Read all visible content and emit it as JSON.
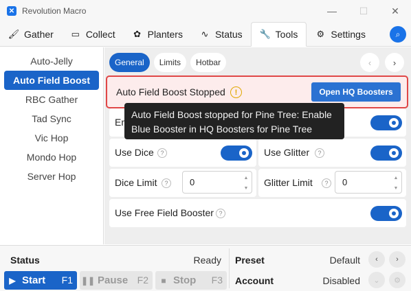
{
  "window": {
    "app_icon": "macro-icon",
    "title": "Revolution Macro",
    "minimize": "—",
    "maximize": "☐",
    "close": "✕"
  },
  "tabs": [
    {
      "label": "Gather",
      "icon": "brush-icon",
      "glyph": "🖌"
    },
    {
      "label": "Collect",
      "icon": "ticket-icon",
      "glyph": "▭"
    },
    {
      "label": "Planters",
      "icon": "plant-icon",
      "glyph": "✿"
    },
    {
      "label": "Status",
      "icon": "pulse-icon",
      "glyph": "∿"
    },
    {
      "label": "Tools",
      "icon": "wrench-icon",
      "glyph": "🔧",
      "active": true
    },
    {
      "label": "Settings",
      "icon": "gear-icon",
      "glyph": "⚙"
    }
  ],
  "search_glyph": "⌕",
  "sidebar": {
    "items": [
      {
        "label": "Auto-Jelly"
      },
      {
        "label": "Auto Field Boost",
        "active": true
      },
      {
        "label": "RBC Gather"
      },
      {
        "label": "Tad Sync"
      },
      {
        "label": "Vic Hop"
      },
      {
        "label": "Mondo Hop"
      },
      {
        "label": "Server Hop"
      }
    ]
  },
  "subtabs": [
    {
      "label": "General",
      "active": true
    },
    {
      "label": "Limits"
    },
    {
      "label": "Hotbar"
    }
  ],
  "nav": {
    "prev": "‹",
    "next": "›"
  },
  "status_banner": {
    "text": "Auto Field Boost Stopped",
    "warn_glyph": "!",
    "button": "Open HQ Boosters"
  },
  "tooltip": {
    "line1": "Auto Field Boost stopped for Pine Tree: Enable",
    "line2": "Blue Booster in HQ Boosters for Pine Tree"
  },
  "options": {
    "enable_label": "En",
    "enable_on": true,
    "use_dice": {
      "label": "Use Dice",
      "on": true
    },
    "use_glitter": {
      "label": "Use Glitter",
      "on": true
    },
    "dice_limit": {
      "label": "Dice Limit",
      "value": "0"
    },
    "glitter_limit": {
      "label": "Glitter Limit",
      "value": "0"
    },
    "free_field_booster": {
      "label": "Use Free Field Booster",
      "on": true
    },
    "help_glyph": "?"
  },
  "bottom": {
    "status_label": "Status",
    "status_value": "Ready",
    "start": {
      "label": "Start",
      "key": "F1",
      "glyph": "▶"
    },
    "pause": {
      "label": "Pause",
      "key": "F2",
      "glyph": "❚❚"
    },
    "stop": {
      "label": "Stop",
      "key": "F3",
      "glyph": "■"
    },
    "preset_label": "Preset",
    "preset_value": "Default",
    "account_label": "Account",
    "account_value": "Disabled",
    "prev_glyph": "‹",
    "next_glyph": "›",
    "dropdown_glyph": "⌄",
    "settings_glyph": "⚙"
  },
  "colors": {
    "accent": "#1a64c8",
    "banner_border": "#e04646",
    "banner_bg": "#fdecec",
    "warning": "#e0a800"
  }
}
